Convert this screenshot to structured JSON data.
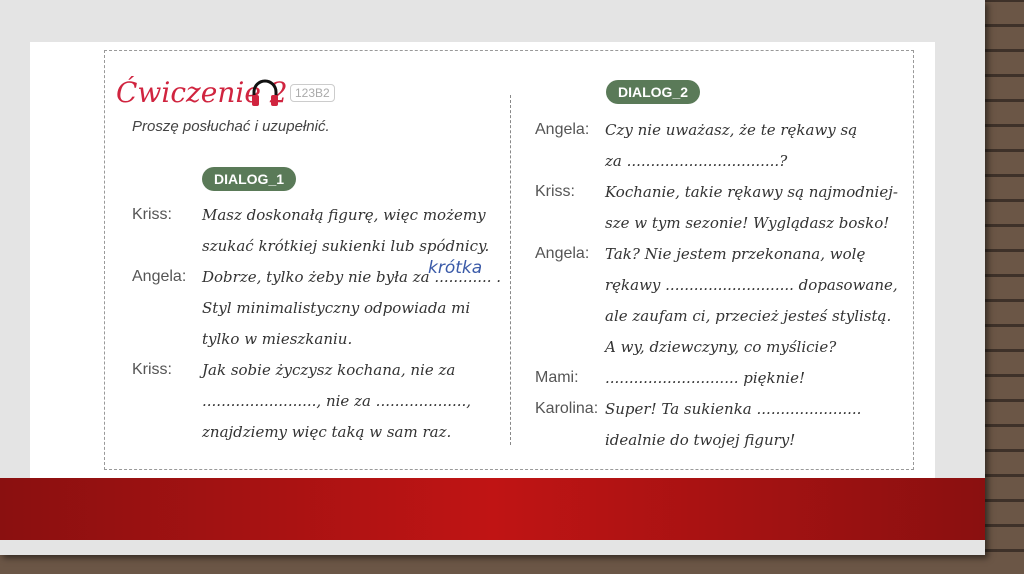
{
  "exercise": {
    "title": "Ćwiczenie 2",
    "code": "123B2",
    "instruction": "Proszę posłuchać i uzupełnić."
  },
  "dialog1": {
    "label": "DIALOG_1",
    "lines": [
      {
        "speaker": "Kriss:",
        "text": "Masz doskonałą figurę, więc możemy"
      },
      {
        "speaker": "",
        "text": "szukać krótkiej sukienki lub spódnicy."
      },
      {
        "speaker": "Angela:",
        "text": "Dobrze, tylko żeby nie była za ............ ."
      },
      {
        "speaker": "",
        "text": "Styl minimalistyczny odpowiada mi"
      },
      {
        "speaker": "",
        "text": "tylko w mieszkaniu."
      },
      {
        "speaker": "Kriss:",
        "text": "Jak sobie życzysz kochana, nie za"
      },
      {
        "speaker": "",
        "text": "........................, nie za ...................,"
      },
      {
        "speaker": "",
        "text": "znajdziemy więc taką w sam raz."
      }
    ],
    "handwritten": "krótka"
  },
  "dialog2": {
    "label": "DIALOG_2",
    "lines": [
      {
        "speaker": "Angela:",
        "text": "Czy nie uważasz, że te rękawy są"
      },
      {
        "speaker": "",
        "text": "za ................................?"
      },
      {
        "speaker": "Kriss:",
        "text": "Kochanie, takie rękawy są najmodniej-"
      },
      {
        "speaker": "",
        "text": "sze w tym sezonie! Wyglądasz bosko!"
      },
      {
        "speaker": "Angela:",
        "text": "Tak? Nie jestem przekonana, wolę"
      },
      {
        "speaker": "",
        "text": "rękawy ........................... dopasowane,"
      },
      {
        "speaker": "",
        "text": "ale zaufam ci, przecież jesteś stylistą."
      },
      {
        "speaker": "",
        "text": "A wy, dziewczyny, co myślicie?"
      },
      {
        "speaker": "Mami:",
        "text": "............................ pięknie!"
      },
      {
        "speaker": "Karolina:",
        "text": "Super! Ta sukienka ......................"
      },
      {
        "speaker": "",
        "text": "idealnie do twojej figury!"
      }
    ]
  }
}
